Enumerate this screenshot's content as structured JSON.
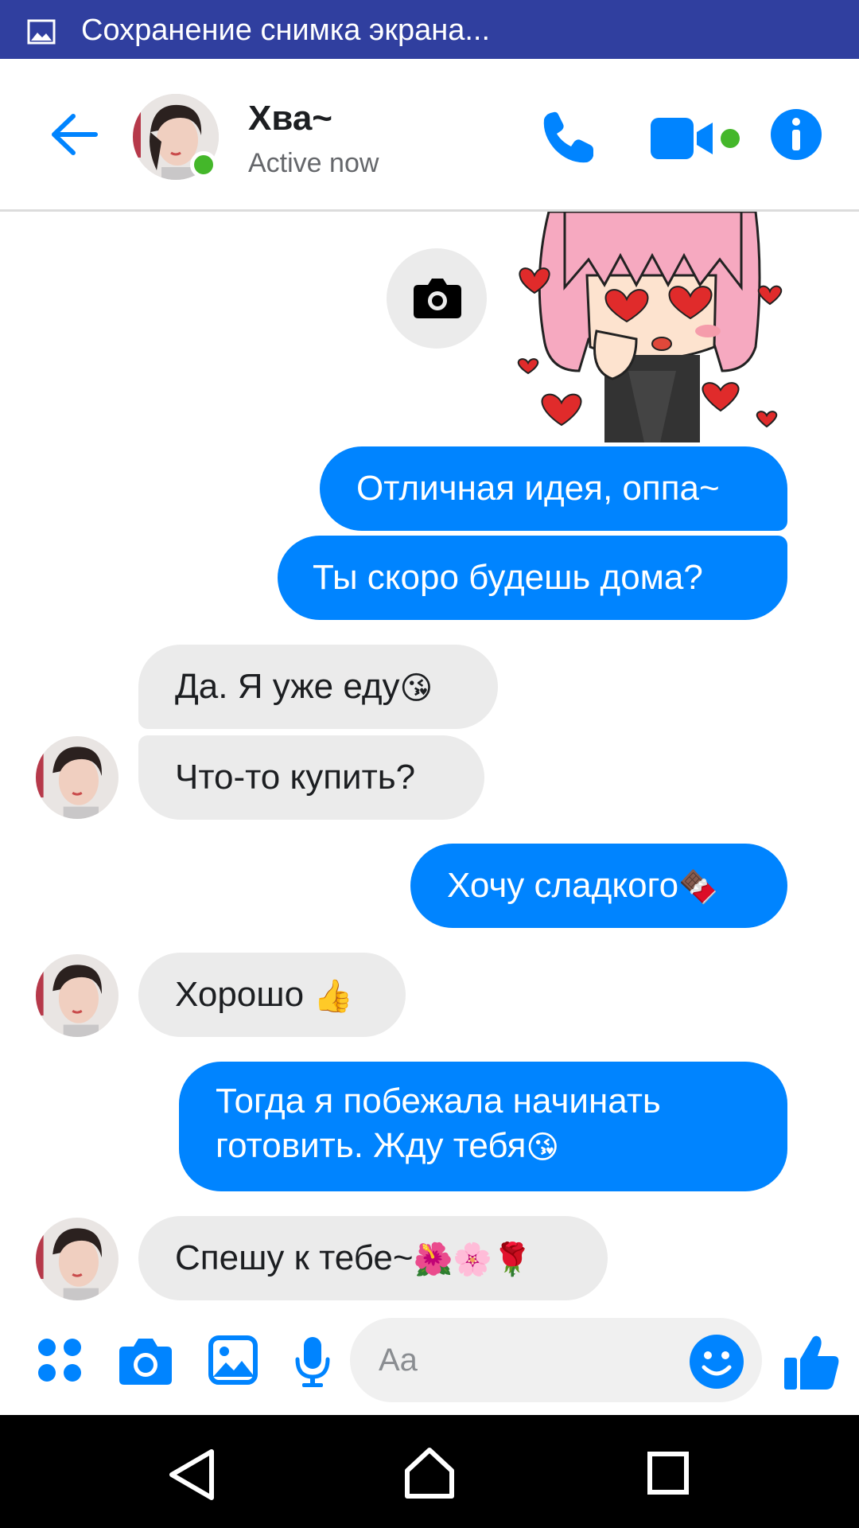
{
  "status_bar": {
    "text": "Сохранение снимка экрана...",
    "icon": "image-icon",
    "background": "#303f9f"
  },
  "header": {
    "contact_name": "Хва~",
    "contact_status": "Active now",
    "icons": [
      "back-arrow-icon",
      "phone-icon",
      "video-camera-icon",
      "info-icon"
    ],
    "accent_color": "#0084ff",
    "online_color": "#44b72a"
  },
  "messages": [
    {
      "side": "outgoing",
      "type": "sticker",
      "sticker": "girl-with-heart-eyes"
    },
    {
      "side": "outgoing",
      "text": "Отличная идея, оппа~"
    },
    {
      "side": "outgoing",
      "text": "Ты скоро будешь дома?"
    },
    {
      "side": "incoming",
      "text": "Да. Я уже еду",
      "emoji": "😘"
    },
    {
      "side": "incoming",
      "text": "Что-то купить?"
    },
    {
      "side": "outgoing",
      "text": "Хочу сладкого",
      "emoji": "🍫"
    },
    {
      "side": "incoming",
      "text": "Хорошо",
      "emoji": "👍"
    },
    {
      "side": "outgoing",
      "text_line1": "Тогда я побежала начинать",
      "text_line2": "готовить. Жду тебя",
      "emoji": "😘"
    },
    {
      "side": "incoming",
      "text": "Спешу к тебе~",
      "emoji": "🌺🌸🌹"
    }
  ],
  "composer": {
    "placeholder": "Aa",
    "icons": [
      "apps-icon",
      "camera-icon",
      "gallery-icon",
      "microphone-icon",
      "emoji-icon",
      "thumbs-up-icon"
    ]
  },
  "nav_bar": {
    "icons": [
      "nav-back-icon",
      "nav-home-icon",
      "nav-recents-icon"
    ]
  }
}
